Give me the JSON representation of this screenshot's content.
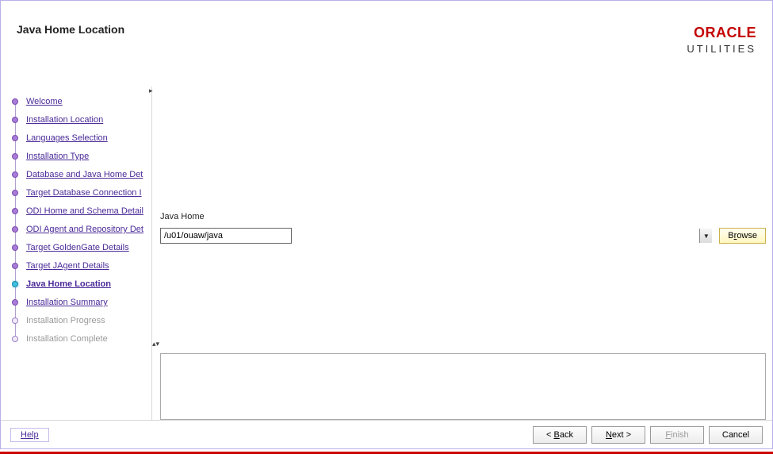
{
  "header": {
    "title": "Java Home Location",
    "brand": "ORACLE",
    "brand_sub": "UTILITIES"
  },
  "sidebar": {
    "steps": [
      {
        "label": "Welcome",
        "state": "done"
      },
      {
        "label": "Installation Location",
        "state": "done"
      },
      {
        "label": "Languages Selection",
        "state": "done"
      },
      {
        "label": "Installation Type",
        "state": "done"
      },
      {
        "label": "Database and Java Home Det",
        "state": "done"
      },
      {
        "label": "Target Database Connection I",
        "state": "done"
      },
      {
        "label": "ODI Home and Schema Detail",
        "state": "done"
      },
      {
        "label": "ODI Agent and Repository Det",
        "state": "done"
      },
      {
        "label": "Target GoldenGate Details",
        "state": "done"
      },
      {
        "label": "Target JAgent Details",
        "state": "done"
      },
      {
        "label": "Java Home Location",
        "state": "current"
      },
      {
        "label": "Installation Summary",
        "state": "next"
      },
      {
        "label": "Installation Progress",
        "state": "pending"
      },
      {
        "label": "Installation Complete",
        "state": "pending"
      }
    ]
  },
  "form": {
    "java_home_label": "Java Home",
    "java_home_value": "/u01/ouaw/java",
    "browse_label": "Browse"
  },
  "footer": {
    "help": "Help",
    "back": "< Back",
    "next": "Next >",
    "finish": "Finish",
    "cancel": "Cancel"
  }
}
